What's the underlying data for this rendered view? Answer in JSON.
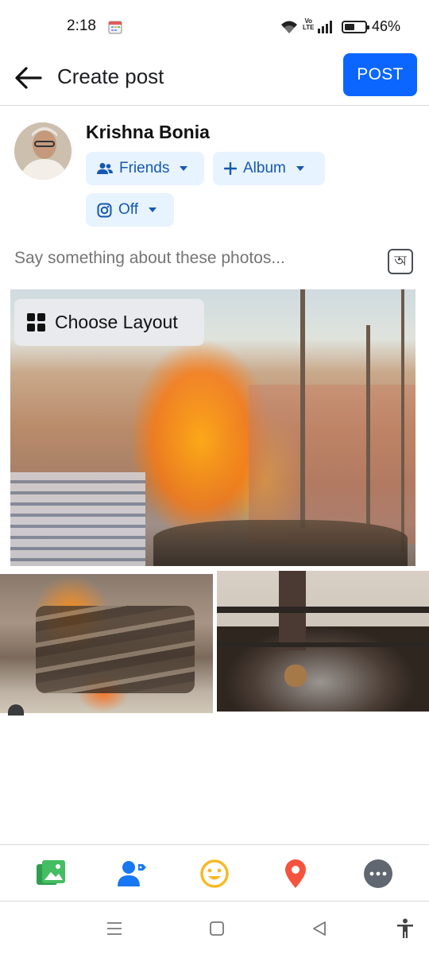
{
  "status_bar": {
    "time": "2:18",
    "volte_label": "Vo\nLTE",
    "battery_percent": "46%",
    "battery_level": 0.46
  },
  "header": {
    "title": "Create post",
    "post_label": "POST",
    "accent_color": "#0a66ff"
  },
  "user": {
    "name": "Krishna Bonia"
  },
  "audience": {
    "friends_label": "Friends",
    "album_label": "Album",
    "instagram_label": "Off"
  },
  "composer": {
    "placeholder": "Say something about these photos...",
    "transliterate_glyph": "অ"
  },
  "photos": {
    "choose_layout_label": "Choose Layout",
    "count": 3
  },
  "toolbar": {
    "icons": [
      "photo-icon",
      "tag-people-icon",
      "feeling-icon",
      "check-in-icon",
      "more-icon"
    ],
    "colors": {
      "photo": "#45bd62",
      "tag": "#1877f2",
      "feeling": "#f7b928",
      "checkin": "#f5533d",
      "more": "#606770"
    }
  },
  "navbar": {
    "icons": [
      "menu-icon",
      "home-icon",
      "back-icon",
      "accessibility-icon"
    ]
  }
}
